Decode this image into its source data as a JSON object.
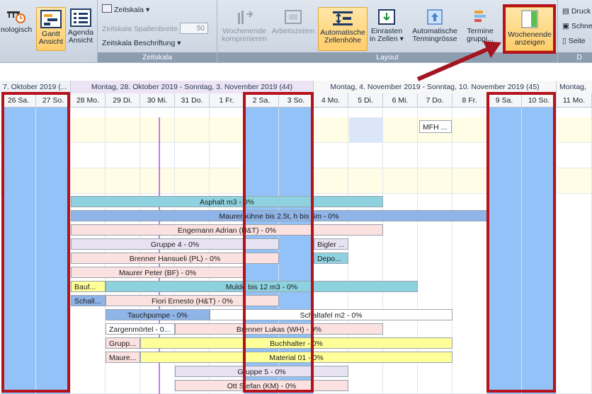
{
  "ribbon": {
    "btn_chrono": "nologisch",
    "btn_gantt": [
      "Gantt",
      "Ansicht"
    ],
    "btn_agenda": [
      "Agenda",
      "Ansicht"
    ],
    "zeitskala": "Zeitskala",
    "spaltenbreite": "Zeitskala Spaltenbreite",
    "spaltenbreite_value": "50",
    "beschriftung": "Zeitskala Beschriftung",
    "group_zeitskala": "Zeitskala",
    "btn_komprimieren": [
      "Wochenende",
      "komprimieren"
    ],
    "btn_arbeitszeiten": [
      "Arbeitszeiten",
      ""
    ],
    "btn_zellenhoehe": [
      "Automatische",
      "Zellenhöhe"
    ],
    "btn_einrasten": [
      "Einrasten",
      "in Zellen"
    ],
    "btn_termingroesse": [
      "Automatische",
      "Termingrösse"
    ],
    "btn_termine": [
      "Termine",
      "gruppi..."
    ],
    "btn_wochenende": [
      "Wochenende",
      "anzeigen"
    ],
    "group_layout": "Layout",
    "druck": [
      "Druck",
      "Schne",
      "Seite"
    ],
    "group_d": "D"
  },
  "weeks": [
    "7. Oktober 2019 (...",
    "Montag, 28. Oktober 2019 - Sonntag, 3. November 2019 (44)",
    "Montag, 4. November 2019 - Sonntag, 10. November 2019 (45)",
    "Montag,"
  ],
  "days": [
    "26 Sa.",
    "27 So.",
    "28 Mo.",
    "29 Di.",
    "30 Mi.",
    "31 Do.",
    "1 Fr.",
    "2 Sa.",
    "3 So.",
    "4 Mo.",
    "5 Di.",
    "6 Mi.",
    "7 Do.",
    "8 Fr.",
    "9 Sa.",
    "10 So.",
    "11 Mo."
  ],
  "weekend_days": [
    "26 Sa.",
    "27 So.",
    "2 Sa.",
    "3 So.",
    "9 Sa.",
    "10 So."
  ],
  "tasks": {
    "mfh": "MFH ...",
    "asphalt": "Asphalt m3 - 0%",
    "maurerbuehne": "Maurerbühne bis 2.5t, h bis 6m - 0%",
    "engemann": "Engemann Adrian (H&T) - 0%",
    "gruppe4": "Gruppe 4 - 0%",
    "bigler": "Bigler ...",
    "brenner_h": "Brenner Hansueli (PL) - 0%",
    "depo": "Depo...",
    "maurer_peter": "Maurer Peter (BF) - 0%",
    "bauf": "Bauf...",
    "mulde": "Mulde bis 12 m3 - 0%",
    "schall": "Schall...",
    "fiori": "Fiori Ernesto (H&T) - 0%",
    "tauchpumpe": "Tauchpumpe - 0%",
    "schaltafel": "Schaltafel m2 - 0%",
    "zargen": "Zargenmörtel - 0...",
    "brenner_l": "Brenner Lukas (WH) - 0%",
    "grupp": "Grupp...",
    "buchhalter": "Buchhalter - 0%",
    "maure": "Maure...",
    "material": "Material 01 - 0%",
    "gruppe5": "Gruppe 5 - 0%",
    "ott": "Ott Stefan (KM) - 0%"
  },
  "colors": {
    "weekend": "#92c2f7",
    "highlight": "#b5121b",
    "arrow": "#a31620",
    "active": "#ffcd6a"
  }
}
